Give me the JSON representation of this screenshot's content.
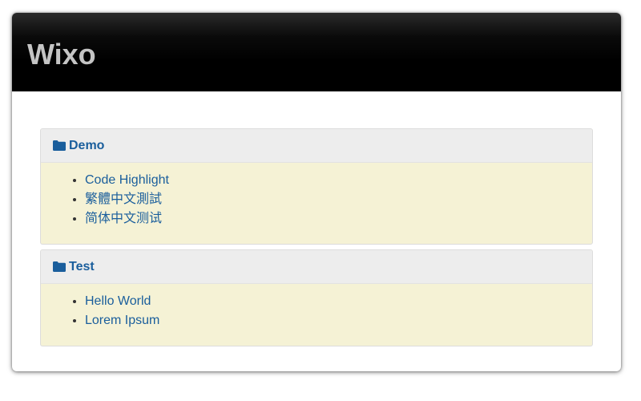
{
  "site": {
    "title": "Wixo"
  },
  "colors": {
    "header_bg": "#000000",
    "title_text": "#c4c4c4",
    "link": "#1a5e9c",
    "panel_heading_bg": "#ededed",
    "panel_body_bg": "#f5f2d5"
  },
  "categories": [
    {
      "icon": "folder-icon",
      "name": "Demo",
      "items": [
        "Code Highlight",
        "繁體中文測試",
        "简体中文测试"
      ]
    },
    {
      "icon": "folder-icon",
      "name": "Test",
      "items": [
        "Hello World",
        "Lorem Ipsum"
      ]
    }
  ]
}
